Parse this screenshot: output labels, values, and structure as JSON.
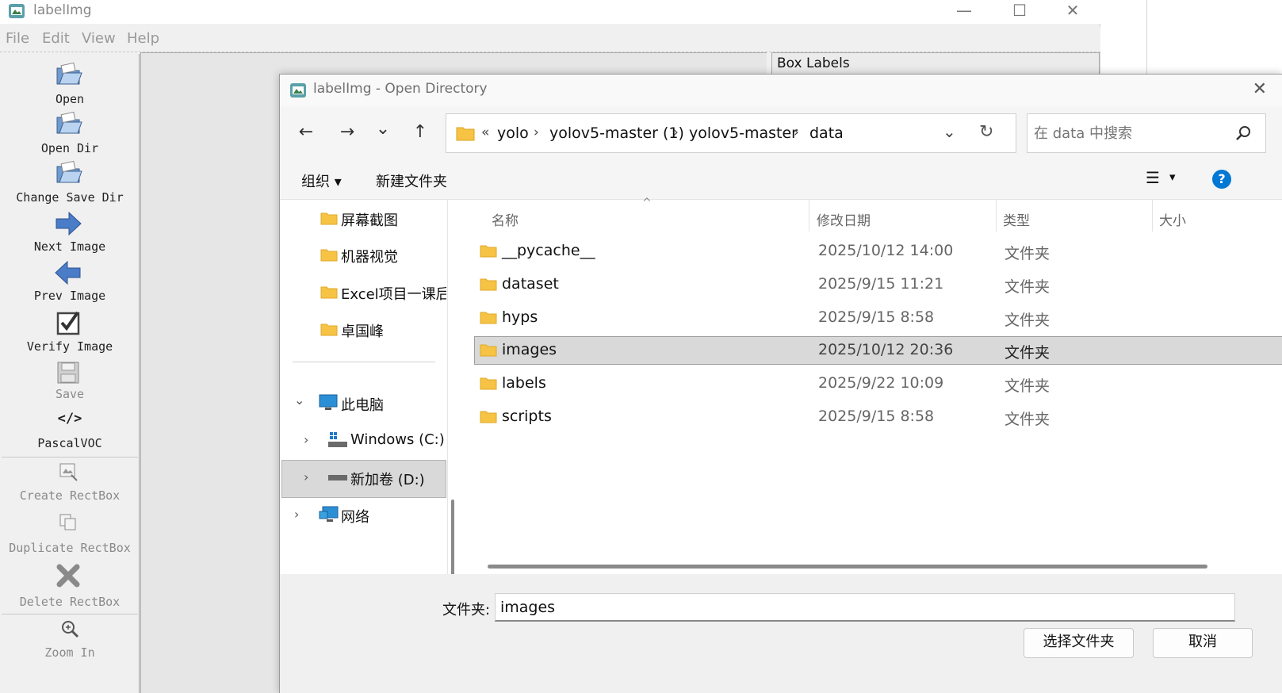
{
  "main_window": {
    "title": "labelImg",
    "minimize_glyph": "—",
    "maximize_glyph": "☐",
    "close_glyph": "✕",
    "menu": [
      "File",
      "Edit",
      "View",
      "Help"
    ],
    "box_labels": "Box Labels"
  },
  "toolbar": [
    {
      "label": "Open",
      "icon": "folder-open-icon",
      "enabled": true
    },
    {
      "label": "Open Dir",
      "icon": "folder-open-icon",
      "enabled": true
    },
    {
      "label": "Change Save Dir",
      "icon": "folder-open-icon",
      "enabled": true
    },
    {
      "label": "Next Image",
      "icon": "arrow-right-icon",
      "enabled": true
    },
    {
      "label": "Prev Image",
      "icon": "arrow-left-icon",
      "enabled": true
    },
    {
      "label": "Verify Image",
      "icon": "checkbox-icon",
      "enabled": true
    },
    {
      "label": "Save",
      "icon": "floppy-icon",
      "enabled": false
    },
    {
      "label": "PascalVOC",
      "icon": "code-icon",
      "icon_text": "</>",
      "enabled": true
    },
    {
      "label": "Create RectBox",
      "icon": "create-rectbox-icon",
      "enabled": false
    },
    {
      "label": "Duplicate RectBox",
      "icon": "duplicate-icon",
      "enabled": false
    },
    {
      "label": "Delete RectBox",
      "icon": "delete-x-icon",
      "enabled": false
    },
    {
      "label": "Zoom In",
      "icon": "zoom-in-icon",
      "enabled": false
    }
  ],
  "dialog": {
    "title": "labelImg - Open Directory",
    "close_glyph": "✕",
    "nav": {
      "back": "←",
      "forward": "→",
      "recent": "⌄",
      "up": "↑"
    },
    "breadcrumb": {
      "overflow": "«",
      "items": [
        "yolo",
        "yolov5-master (1)",
        "yolov5-master",
        "data"
      ],
      "separator": "›",
      "dropdown": "⌄",
      "refresh": "↻"
    },
    "search": {
      "placeholder": "在 data 中搜索"
    },
    "commands": {
      "organize": "组织 ▾",
      "new_folder": "新建文件夹",
      "view_glyph": "☰",
      "view_arrow": "▾",
      "help": "?"
    },
    "navpane": {
      "quick_access": [
        "屏幕截图",
        "机器视觉",
        "Excel项目一课后",
        "卓国峰"
      ],
      "this_pc": "此电脑",
      "drives": [
        "Windows (C:)",
        "新加卷 (D:)"
      ],
      "network": "网络",
      "chevron_expanded": "⌄",
      "chevron_collapsed": "›"
    },
    "columns": {
      "name": "名称",
      "modified": "修改日期",
      "type": "类型",
      "size": "大小",
      "sort_indicator": "^"
    },
    "files": [
      {
        "name": "__pycache__",
        "modified": "2025/10/12 14:00",
        "type": "文件夹"
      },
      {
        "name": "dataset",
        "modified": "2025/9/15 11:21",
        "type": "文件夹"
      },
      {
        "name": "hyps",
        "modified": "2025/9/15 8:58",
        "type": "文件夹"
      },
      {
        "name": "images",
        "modified": "2025/10/12 20:36",
        "type": "文件夹"
      },
      {
        "name": "labels",
        "modified": "2025/9/22 10:09",
        "type": "文件夹"
      },
      {
        "name": "scripts",
        "modified": "2025/9/15 8:58",
        "type": "文件夹"
      }
    ],
    "selected_file": "images",
    "folder_field": {
      "label": "文件夹:",
      "value": "images"
    },
    "buttons": {
      "select": "选择文件夹",
      "cancel": "取消"
    }
  },
  "colors": {
    "folder": "#f6c344",
    "selection": "#d9d9d9",
    "help": "#0078d4",
    "arrow_blue": "#4a7cc7"
  }
}
